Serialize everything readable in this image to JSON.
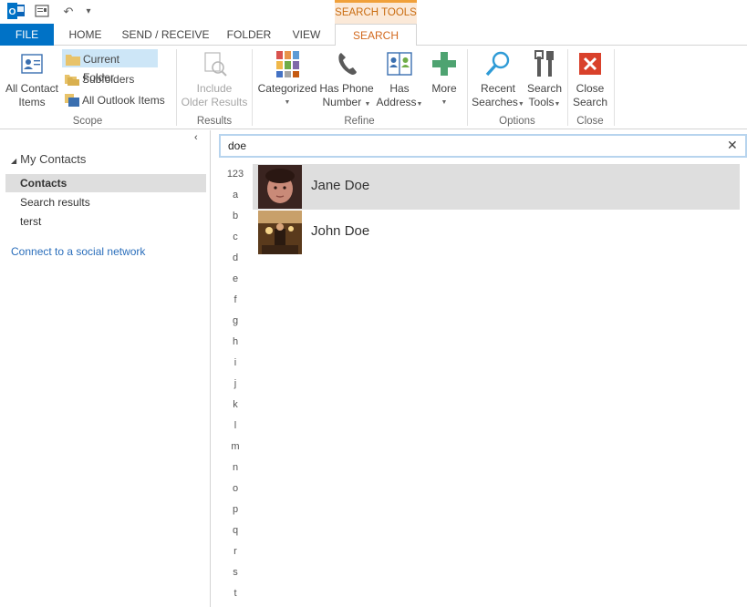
{
  "qat": {
    "icons": [
      "outlook-logo",
      "send-receive-all-icon",
      "undo-icon",
      "customize-qat-icon"
    ],
    "undo_glyph": "↶",
    "customize_glyph": "▾"
  },
  "contextual_header": "SEARCH TOOLS",
  "tabs": [
    "FILE",
    "HOME",
    "SEND / RECEIVE",
    "FOLDER",
    "VIEW",
    "SEARCH"
  ],
  "ribbon": {
    "scope": {
      "label": "Scope",
      "all_contact_items": [
        "All Contact",
        "Items"
      ],
      "current_folder": "Current Folder",
      "subfolders": "Subfolders",
      "all_outlook_items": "All Outlook Items"
    },
    "results": {
      "label": "Results",
      "include_older": [
        "Include",
        "Older Results"
      ]
    },
    "refine": {
      "label": "Refine",
      "categorized": "Categorized",
      "has_phone": [
        "Has Phone",
        "Number"
      ],
      "has_address": [
        "Has",
        "Address"
      ],
      "more": "More"
    },
    "options": {
      "label": "Options",
      "recent_searches": [
        "Recent",
        "Searches"
      ],
      "search_tools": [
        "Search",
        "Tools"
      ]
    },
    "close": {
      "label": "Close",
      "close_search": [
        "Close",
        "Search"
      ]
    },
    "colors": {
      "accent": "#0072c6",
      "contextual": "#d2691e",
      "active_small": "#cde6f7"
    }
  },
  "nav": {
    "collapse_glyph": "‹",
    "root": "My Contacts",
    "items": [
      "Contacts",
      "Search results",
      "terst"
    ],
    "selected": "Contacts",
    "social_link": "Connect to a social network"
  },
  "search": {
    "query": "doe",
    "clear_glyph": "✕"
  },
  "alphabet": [
    "123",
    "a",
    "b",
    "c",
    "d",
    "e",
    "f",
    "g",
    "h",
    "i",
    "j",
    "k",
    "l",
    "m",
    "n",
    "o",
    "p",
    "q",
    "r",
    "s",
    "t"
  ],
  "contacts": [
    {
      "name": "Jane Doe",
      "selected": true
    },
    {
      "name": "John Doe",
      "selected": false
    }
  ]
}
